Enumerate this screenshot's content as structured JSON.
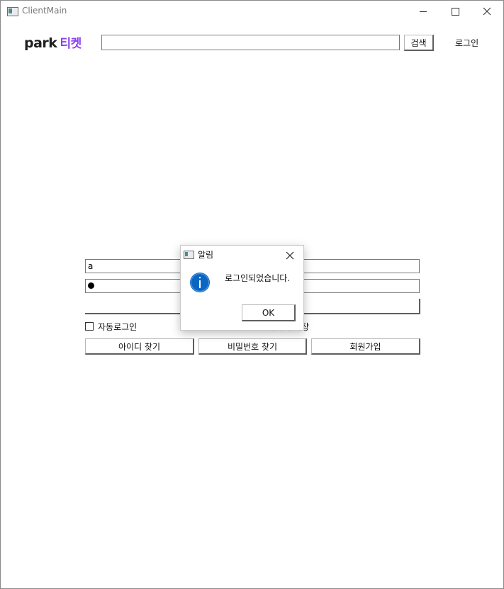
{
  "window": {
    "title": "ClientMain"
  },
  "header": {
    "logo_park": "park",
    "logo_ticket": "티켓",
    "search_value": "",
    "search_button": "검색",
    "login_link": "로그인"
  },
  "login_form": {
    "id_value": "a",
    "auto_login_label": "자동로그인",
    "save_id_label": "아이디 저장",
    "find_id_button": "아이디 찾기",
    "find_pw_button": "비밀번호 찾기",
    "signup_button": "회원가입"
  },
  "dialog": {
    "title": "알림",
    "message": "로그인되었습니다.",
    "ok_button": "OK",
    "icon": "info-icon"
  },
  "colors": {
    "brand_accent": "#8b3ff0",
    "info_blue": "#0a66c2"
  }
}
